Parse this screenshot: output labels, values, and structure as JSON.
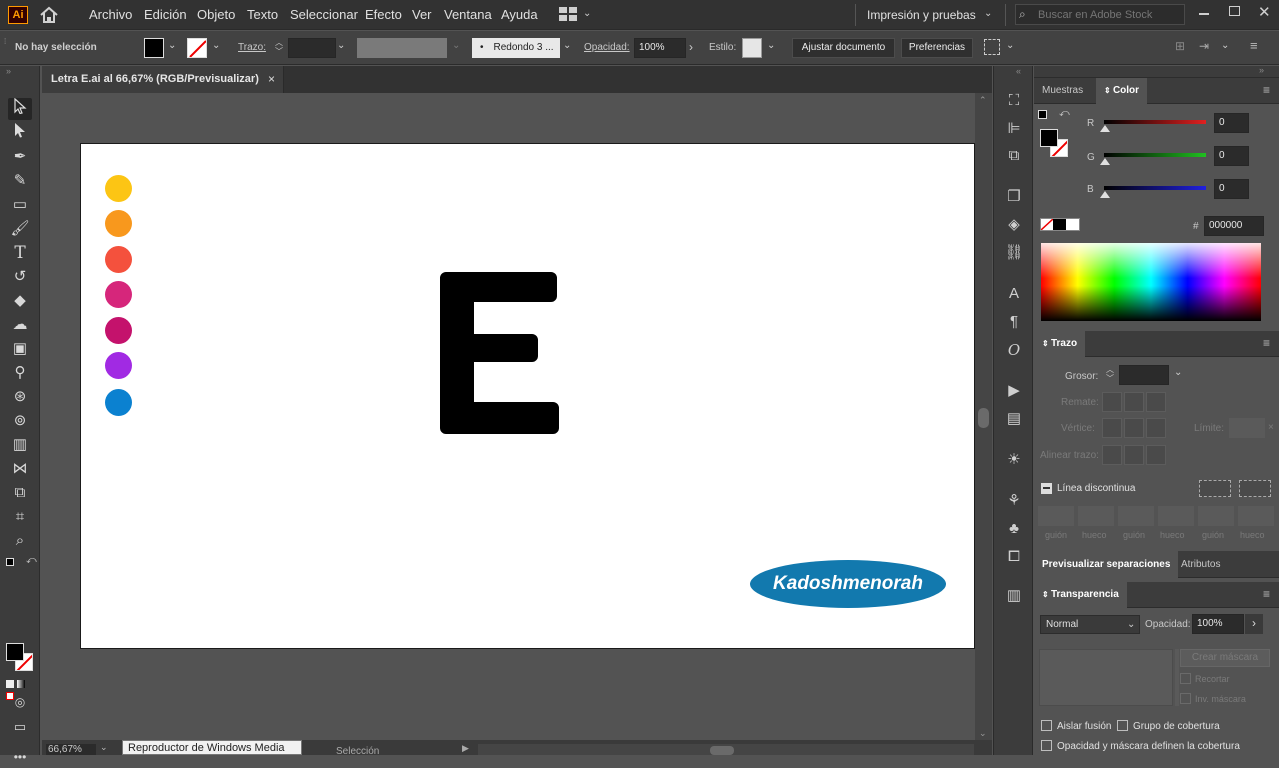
{
  "app": {
    "logo": "Ai"
  },
  "menu": [
    "Archivo",
    "Edición",
    "Objeto",
    "Texto",
    "Seleccionar",
    "Efecto",
    "Ver",
    "Ventana",
    "Ayuda"
  ],
  "workspace": "Impresión y pruebas",
  "search": {
    "placeholder": "Buscar en Adobe Stock"
  },
  "control": {
    "selection": "No hay selección",
    "stroke_label": "Trazo:",
    "brush": "Redondo 3 ...",
    "opacity_label": "Opacidad:",
    "opacity": "100%",
    "style_label": "Estilo:",
    "doc_button": "Ajustar documento",
    "prefs_button": "Preferencias"
  },
  "document": {
    "tab": "Letra E.ai al 66,67% (RGB/Previsualizar)",
    "close": "×",
    "letter": "E",
    "logo_text": "Kadoshmenorah",
    "dot_colors": [
      "#fcc514",
      "#f8981d",
      "#f4513d",
      "#d6267b",
      "#c4126c",
      "#a12ae3",
      "#0b81d0"
    ]
  },
  "status": {
    "zoom": "66,67%",
    "tooltip": "Reproductor de Windows Media",
    "tool": "Selección"
  },
  "color_panel": {
    "tabs": [
      "Muestras",
      "Color"
    ],
    "channels": [
      {
        "name": "R",
        "value": "0",
        "color": "#e02020"
      },
      {
        "name": "G",
        "value": "0",
        "color": "#20c020"
      },
      {
        "name": "B",
        "value": "0",
        "color": "#2020e0"
      }
    ],
    "hex_prefix": "#",
    "hex": "000000"
  },
  "stroke_panel": {
    "title": "Trazo",
    "weight_label": "Grosor:",
    "cap_label": "Remate:",
    "corner_label": "Vértice:",
    "limit_label": "Límite:",
    "align_label": "Alinear trazo:",
    "dashed_label": "Línea discontinua",
    "dash_labels": [
      "guión",
      "hueco",
      "guión",
      "hueco",
      "guión",
      "hueco"
    ]
  },
  "tabs2": [
    "Previsualizar separaciones",
    "Atributos"
  ],
  "transparency": {
    "title": "Transparencia",
    "mode": "Normal",
    "opacity_label": "Opacidad:",
    "opacity": "100%",
    "make_mask": "Crear máscara",
    "clip": "Recortar",
    "invert": "Inv. máscara",
    "isolate": "Aislar fusión",
    "knockout": "Grupo de cobertura",
    "opacity_mask": "Opacidad y máscara definen la cobertura"
  }
}
